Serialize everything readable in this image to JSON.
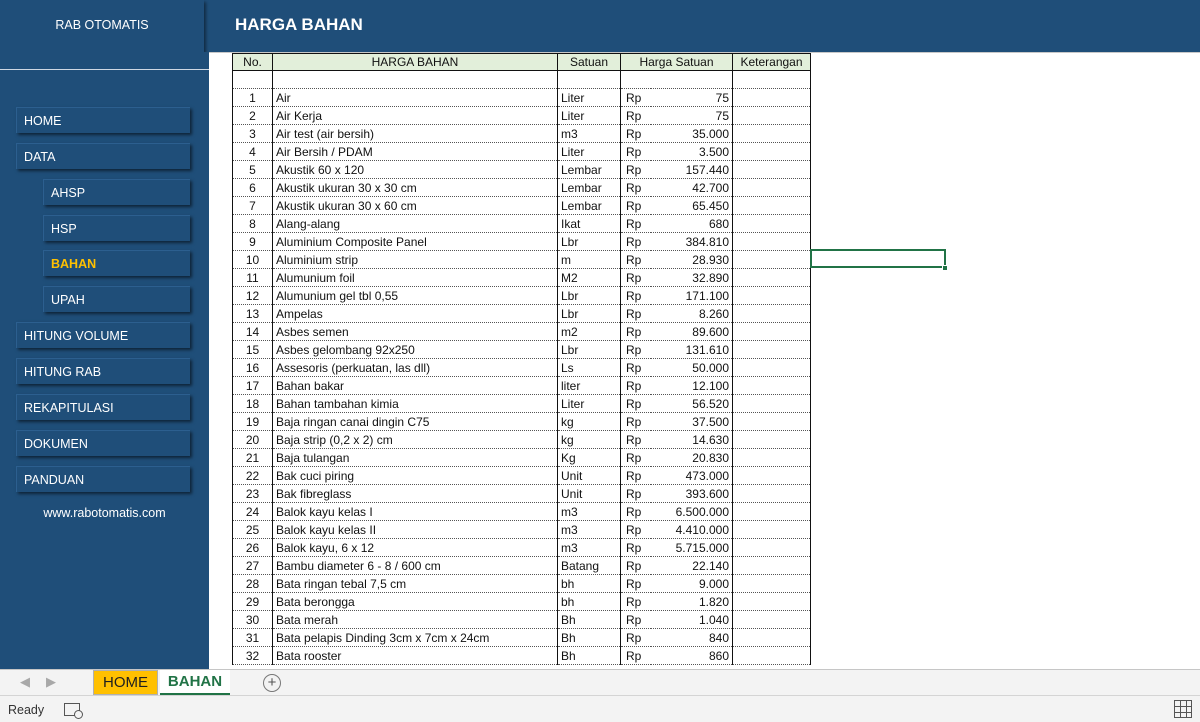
{
  "app": {
    "title": "RAB OTOMATIS",
    "page_title": "HARGA BAHAN"
  },
  "sidebar": {
    "items": [
      {
        "label": "HOME",
        "level": "main",
        "active": false
      },
      {
        "label": "DATA",
        "level": "main",
        "active": false
      },
      {
        "label": "AHSP",
        "level": "sub",
        "active": false
      },
      {
        "label": "HSP",
        "level": "sub",
        "active": false
      },
      {
        "label": "BAHAN",
        "level": "sub",
        "active": true
      },
      {
        "label": "UPAH",
        "level": "sub",
        "active": false
      },
      {
        "label": "HITUNG VOLUME",
        "level": "main",
        "active": false
      },
      {
        "label": "HITUNG RAB",
        "level": "main",
        "active": false
      },
      {
        "label": "REKAPITULASI",
        "level": "main",
        "active": false
      },
      {
        "label": "DOKUMEN",
        "level": "main",
        "active": false
      },
      {
        "label": "PANDUAN",
        "level": "main",
        "active": false
      }
    ],
    "website": "www.rabotomatis.com"
  },
  "table": {
    "headers": [
      "No.",
      "HARGA BAHAN",
      "Satuan",
      "Harga Satuan",
      "Keterangan"
    ],
    "currency": "Rp",
    "rows": [
      {
        "no": "1",
        "name": "Air",
        "unit": "Liter",
        "price": "75"
      },
      {
        "no": "2",
        "name": "Air Kerja",
        "unit": "Liter",
        "price": "75"
      },
      {
        "no": "3",
        "name": "Air test (air bersih)",
        "unit": "m3",
        "price": "35.000"
      },
      {
        "no": "4",
        "name": "Air Bersih / PDAM",
        "unit": "Liter",
        "price": "3.500"
      },
      {
        "no": "5",
        "name": "Akustik 60 x 120",
        "unit": "Lembar",
        "price": "157.440"
      },
      {
        "no": "6",
        "name": "Akustik ukuran 30 x 30 cm",
        "unit": "Lembar",
        "price": "42.700"
      },
      {
        "no": "7",
        "name": "Akustik ukuran 30 x 60 cm",
        "unit": "Lembar",
        "price": "65.450"
      },
      {
        "no": "8",
        "name": "Alang-alang",
        "unit": "Ikat",
        "price": "680"
      },
      {
        "no": "9",
        "name": "Aluminium Composite Panel",
        "unit": "Lbr",
        "price": "384.810"
      },
      {
        "no": "10",
        "name": "Aluminium strip",
        "unit": "m",
        "price": "28.930"
      },
      {
        "no": "11",
        "name": "Alumunium foil",
        "unit": "M2",
        "price": "32.890"
      },
      {
        "no": "12",
        "name": "Alumunium gel  tbl 0,55",
        "unit": "Lbr",
        "price": "171.100"
      },
      {
        "no": "13",
        "name": "Ampelas",
        "unit": "Lbr",
        "price": "8.260"
      },
      {
        "no": "14",
        "name": "Asbes  semen",
        "unit": "m2",
        "price": "89.600"
      },
      {
        "no": "15",
        "name": "Asbes gelombang 92x250",
        "unit": "Lbr",
        "price": "131.610"
      },
      {
        "no": "16",
        "name": "Assesoris (perkuatan, las dll)",
        "unit": "Ls",
        "price": "50.000"
      },
      {
        "no": "17",
        "name": "Bahan bakar",
        "unit": "liter",
        "price": "12.100"
      },
      {
        "no": "18",
        "name": "Bahan tambahan kimia",
        "unit": "Liter",
        "price": "56.520"
      },
      {
        "no": "19",
        "name": "Baja ringan canai dingin C75",
        "unit": "kg",
        "price": "37.500"
      },
      {
        "no": "20",
        "name": "Baja strip (0,2 x 2) cm",
        "unit": "kg",
        "price": "14.630"
      },
      {
        "no": "21",
        "name": "Baja tulangan",
        "unit": "Kg",
        "price": "20.830"
      },
      {
        "no": "22",
        "name": "Bak cuci piring",
        "unit": "Unit",
        "price": "473.000"
      },
      {
        "no": "23",
        "name": "Bak fibreglass",
        "unit": "Unit",
        "price": "393.600"
      },
      {
        "no": "24",
        "name": "Balok kayu kelas I",
        "unit": "m3",
        "price": "6.500.000"
      },
      {
        "no": "25",
        "name": "Balok kayu kelas II",
        "unit": "m3",
        "price": "4.410.000"
      },
      {
        "no": "26",
        "name": "Balok kayu, 6 x 12",
        "unit": "m3",
        "price": "5.715.000"
      },
      {
        "no": "27",
        "name": "Bambu  diameter 6 - 8  / 600 cm",
        "unit": "Batang",
        "price": "22.140"
      },
      {
        "no": "28",
        "name": "Bata  ringan tebal 7,5 cm",
        "unit": "bh",
        "price": "9.000"
      },
      {
        "no": "29",
        "name": "Bata berongga",
        "unit": "bh",
        "price": "1.820"
      },
      {
        "no": "30",
        "name": "Bata merah",
        "unit": "Bh",
        "price": "1.040"
      },
      {
        "no": "31",
        "name": "Bata pelapis Dinding 3cm x 7cm x 24cm",
        "unit": "Bh",
        "price": "840"
      },
      {
        "no": "32",
        "name": "Bata rooster",
        "unit": "Bh",
        "price": "860"
      }
    ]
  },
  "tabs": [
    {
      "label": "HOME",
      "active": false
    },
    {
      "label": "BAHAN",
      "active": true
    }
  ],
  "add_sheet_symbol": "+",
  "tab_nav": {
    "prev": "◀",
    "next": "▶"
  },
  "status": {
    "text": "Ready"
  },
  "colors": {
    "banner": "#1f4e79",
    "active_nav": "#ffc000",
    "header_fill": "#e2efda",
    "excel_green": "#217346",
    "home_tab": "#ffc000"
  }
}
